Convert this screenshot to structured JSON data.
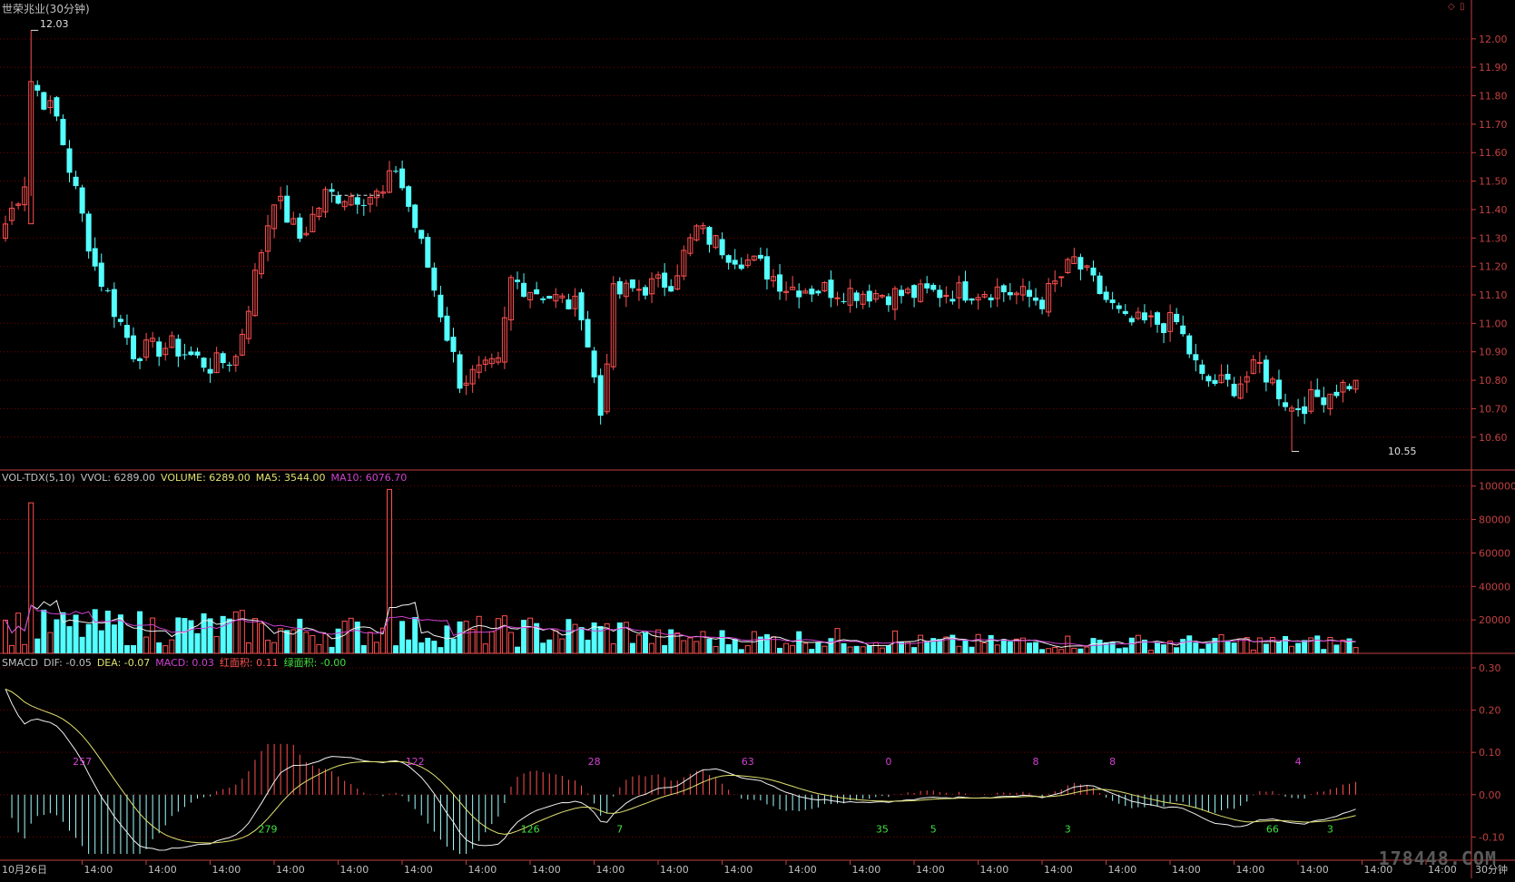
{
  "header": {
    "title": "世荣兆业(30分钟)",
    "high_label": "12.03",
    "low_label": "10.55"
  },
  "colors": {
    "up": "#ff5050",
    "down": "#54ffff",
    "grid": "#7a0000",
    "axis": "#c04040",
    "label_grey": "#c0c0c0",
    "white_line": "#f0f0f0",
    "yellow_line": "#e0e070",
    "magenta_line": "#d040d0",
    "macd_red": "#ff5050",
    "macd_cyan": "#a0ffff"
  },
  "price_axis": {
    "ticks": [
      "12.00",
      "11.90",
      "11.80",
      "11.70",
      "11.60",
      "11.50",
      "11.40",
      "11.30",
      "11.20",
      "11.10",
      "11.00",
      "10.90",
      "10.80",
      "10.70",
      "10.60"
    ],
    "min": 10.51,
    "max": 12.06
  },
  "vol_header": {
    "name": "VOL-TDX(5,10)",
    "vvol": "VVOL: 6289.00",
    "volume": "VOLUME: 6289.00",
    "ma5": "MA5: 3544.00",
    "ma10": "MA10: 6076.70"
  },
  "vol_axis": {
    "ticks": [
      "100000",
      "80000",
      "60000",
      "40000",
      "20000"
    ],
    "max": 102000
  },
  "macd_header": {
    "name": "SMACD",
    "dif": "DIF: -0.05",
    "dea": "DEA: -0.07",
    "macd": "MACD: 0.03",
    "red_area": "红面积: 0.11",
    "green_area": "绿面积: -0.00"
  },
  "macd_axis": {
    "ticks": [
      "0.30",
      "0.20",
      "0.10",
      "0.00",
      "-0.10"
    ],
    "min": -0.155,
    "max": 0.33
  },
  "macd_labels": [
    {
      "text": "257",
      "color": "#d040d0",
      "bar": 12
    },
    {
      "text": "279",
      "color": "#40e040",
      "bar": 41
    },
    {
      "text": "122",
      "color": "#d040d0",
      "bar": 64
    },
    {
      "text": "126",
      "color": "#40e040",
      "bar": 82
    },
    {
      "text": "28",
      "color": "#d040d0",
      "bar": 92
    },
    {
      "text": "7",
      "color": "#40e040",
      "bar": 96
    },
    {
      "text": "63",
      "color": "#d040d0",
      "bar": 116
    },
    {
      "text": "0",
      "color": "#d040d0",
      "bar": 138
    },
    {
      "text": "35",
      "color": "#40e040",
      "bar": 137
    },
    {
      "text": "5",
      "color": "#40e040",
      "bar": 145
    },
    {
      "text": "8",
      "color": "#d040d0",
      "bar": 161
    },
    {
      "text": "3",
      "color": "#40e040",
      "bar": 166
    },
    {
      "text": "8",
      "color": "#d040d0",
      "bar": 173
    },
    {
      "text": "66",
      "color": "#40e040",
      "bar": 198
    },
    {
      "text": "4",
      "color": "#d040d0",
      "bar": 202
    },
    {
      "text": "3",
      "color": "#40e040",
      "bar": 207
    }
  ],
  "time_axis": {
    "labels": [
      "10月26日",
      "14:00",
      "14:00",
      "14:00",
      "14:00",
      "14:00",
      "14:00",
      "14:00",
      "14:00",
      "14:00",
      "14:00",
      "14:00",
      "14:00",
      "14:00",
      "14:00",
      "14:00",
      "14:00",
      "14:00",
      "14:00",
      "14:00",
      "14:00",
      "14:00",
      "14:00"
    ],
    "period": "30分钟"
  },
  "watermark": "178448.COM",
  "icons": [
    "restore-icon",
    "close-icon"
  ],
  "chart_data": {
    "type": "candlestick",
    "title": "世荣兆业(30分钟)",
    "bars": 212,
    "anchors": [
      {
        "i": 0,
        "c": 11.35
      },
      {
        "i": 3,
        "c": 11.5
      },
      {
        "i": 4,
        "c": 11.85
      },
      {
        "i": 8,
        "c": 11.72
      },
      {
        "i": 14,
        "c": 11.2
      },
      {
        "i": 20,
        "c": 10.9
      },
      {
        "i": 26,
        "c": 10.92
      },
      {
        "i": 32,
        "c": 10.85
      },
      {
        "i": 36,
        "c": 10.88
      },
      {
        "i": 42,
        "c": 11.45
      },
      {
        "i": 46,
        "c": 11.3
      },
      {
        "i": 50,
        "c": 11.45
      },
      {
        "i": 59,
        "c": 11.45
      },
      {
        "i": 61,
        "c": 11.55
      },
      {
        "i": 66,
        "c": 11.2
      },
      {
        "i": 71,
        "c": 10.8
      },
      {
        "i": 77,
        "c": 10.85
      },
      {
        "i": 79,
        "c": 11.15
      },
      {
        "i": 90,
        "c": 11.05
      },
      {
        "i": 93,
        "c": 10.68
      },
      {
        "i": 95,
        "c": 11.1
      },
      {
        "i": 104,
        "c": 11.15
      },
      {
        "i": 108,
        "c": 11.33
      },
      {
        "i": 113,
        "c": 11.25
      },
      {
        "i": 118,
        "c": 11.2
      },
      {
        "i": 122,
        "c": 11.13
      },
      {
        "i": 140,
        "c": 11.1
      },
      {
        "i": 155,
        "c": 11.12
      },
      {
        "i": 162,
        "c": 11.08
      },
      {
        "i": 167,
        "c": 11.22
      },
      {
        "i": 175,
        "c": 11.0
      },
      {
        "i": 183,
        "c": 11.0
      },
      {
        "i": 187,
        "c": 10.8
      },
      {
        "i": 192,
        "c": 10.78
      },
      {
        "i": 196,
        "c": 10.85
      },
      {
        "i": 201,
        "c": 10.7
      },
      {
        "i": 206,
        "c": 10.75
      },
      {
        "i": 211,
        "c": 10.8
      }
    ],
    "vol_spikes": [
      {
        "i": 4,
        "v": 90000
      },
      {
        "i": 60,
        "v": 98000
      }
    ],
    "price_range": [
      10.55,
      12.03
    ],
    "volume": {
      "vvol": 6289.0,
      "volume": 6289.0,
      "ma5": 3544.0,
      "ma10": 6076.7
    },
    "macd": {
      "dif": -0.05,
      "dea": -0.07,
      "macd": 0.03,
      "red_area": 0.11,
      "green_area": -0.0
    }
  }
}
